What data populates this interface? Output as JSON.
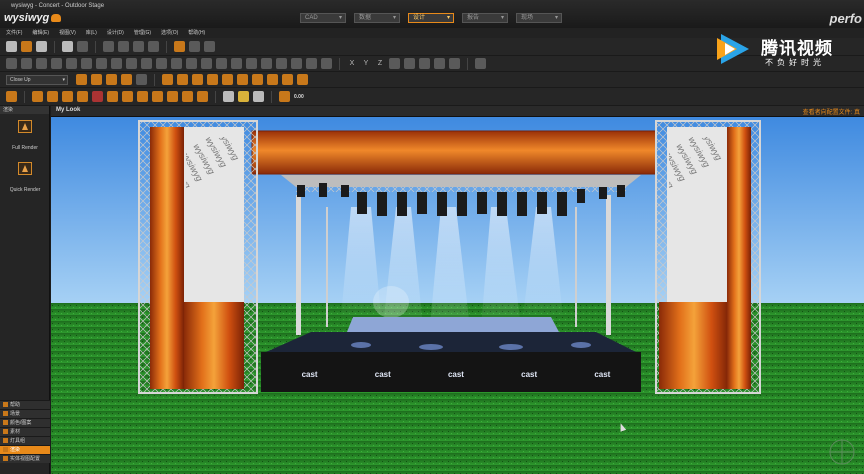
{
  "window": {
    "title": "wysiwyg - Concert - Outdoor Stage",
    "logo_text": "wysiwyg",
    "brand_text": "perfo"
  },
  "modes": [
    {
      "label": "CAD",
      "active": false
    },
    {
      "label": "数据",
      "active": false
    },
    {
      "label": "设计",
      "active": true
    },
    {
      "label": "报告",
      "active": false
    },
    {
      "label": "现场",
      "active": false
    }
  ],
  "menu": [
    "文件(F)",
    "编辑(E)",
    "视图(V)",
    "库(L)",
    "设计(D)",
    "管理(G)",
    "选项(O)",
    "帮助(H)"
  ],
  "toolbar": {
    "view_select": "Close Up",
    "axes": [
      "X",
      "Y",
      "Z"
    ],
    "zoom_readout": "0.00"
  },
  "sidebar": {
    "header": "渲染",
    "tools": [
      {
        "label": "Full Render",
        "icon": "full-render-icon"
      },
      {
        "label": "Quick Render",
        "icon": "quick-render-icon"
      }
    ],
    "grip": "........",
    "tabs": [
      {
        "label": "帮助",
        "active": false
      },
      {
        "label": "场景",
        "active": false
      },
      {
        "label": "颜色/图案",
        "active": false
      },
      {
        "label": "素材",
        "active": false
      },
      {
        "label": "灯具组",
        "active": false
      },
      {
        "label": "渲染",
        "active": true
      },
      {
        "label": "实体视图配置",
        "active": false
      }
    ]
  },
  "viewport": {
    "title": "My Look",
    "status": "查看者向配置文件: 真"
  },
  "scene": {
    "banner_text": "wysiwyg",
    "deck_logo": "cast",
    "deck_logo_count": 5
  },
  "watermark": {
    "title": "腾讯视频",
    "slogan": "不负好时光"
  },
  "colors": {
    "accent": "#e88a1a",
    "sky": "#5aa0e8",
    "grass": "#1f7a1f",
    "fire": "#d35a12"
  }
}
